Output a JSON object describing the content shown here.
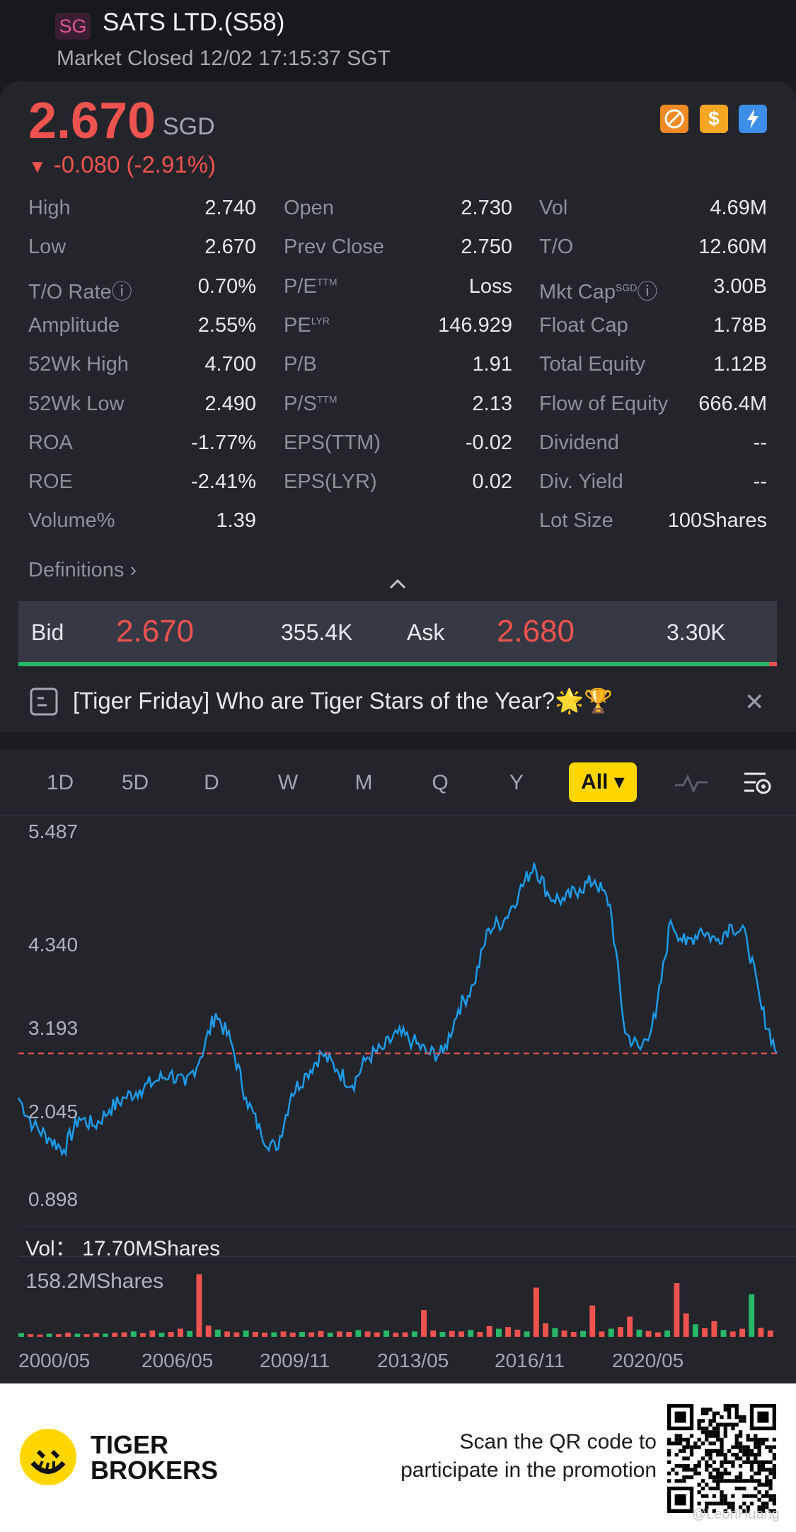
{
  "header": {
    "market_badge": "SG",
    "title": "SATS LTD.(S58)",
    "status": "Market Closed 12/02 17:15:37 SGT"
  },
  "quote": {
    "price": "2.670",
    "currency": "SGD",
    "change_arrow": "▼",
    "change": "-0.080 (-2.91%)",
    "up_color": "#27b86a",
    "down_color": "#ef5350",
    "icons": [
      "no-short-icon",
      "dividend-icon",
      "flash-icon"
    ]
  },
  "stats": {
    "col1": [
      {
        "label": "High",
        "value": "2.740"
      },
      {
        "label": "Low",
        "value": "2.670"
      },
      {
        "label": "T/O Rate",
        "value": "0.70%",
        "info": true
      },
      {
        "label": "Amplitude",
        "value": "2.55%"
      },
      {
        "label": "52Wk High",
        "value": "4.700"
      },
      {
        "label": "52Wk Low",
        "value": "2.490"
      },
      {
        "label": "ROA",
        "value": "-1.77%"
      },
      {
        "label": "ROE",
        "value": "-2.41%"
      },
      {
        "label": "Volume%",
        "value": "1.39"
      }
    ],
    "col2": [
      {
        "label": "Open",
        "value": "2.730"
      },
      {
        "label": "Prev Close",
        "value": "2.750"
      },
      {
        "label": "P/E",
        "sup": "TTM",
        "value": "Loss"
      },
      {
        "label": "PE",
        "sup": "LYR",
        "value": "146.929"
      },
      {
        "label": "P/B",
        "value": "1.91"
      },
      {
        "label": "P/S",
        "sup": "TTM",
        "value": "2.13"
      },
      {
        "label": "EPS(TTM)",
        "value": "-0.02"
      },
      {
        "label": "EPS(LYR)",
        "value": "0.02"
      }
    ],
    "col3": [
      {
        "label": "Vol",
        "value": "4.69M"
      },
      {
        "label": "T/O",
        "value": "12.60M"
      },
      {
        "label": "Mkt Cap",
        "sup": "SGD",
        "value": "3.00B",
        "info": true
      },
      {
        "label": "Float Cap",
        "value": "1.78B"
      },
      {
        "label": "Total Equity",
        "value": "1.12B"
      },
      {
        "label": "Flow of Equity",
        "value": "666.4M"
      },
      {
        "label": "Dividend",
        "value": "--"
      },
      {
        "label": "Div. Yield",
        "value": "--"
      },
      {
        "label": "Lot Size",
        "value": "100Shares"
      }
    ],
    "definitions_label": "Definitions"
  },
  "bidask": {
    "bid_label": "Bid",
    "bid_price": "2.670",
    "bid_size": "355.4K",
    "ask_label": "Ask",
    "ask_price": "2.680",
    "ask_size": "3.30K",
    "bid_ratio": 0.99
  },
  "news": {
    "text": "[Tiger Friday] Who are Tiger Stars of the Year?🌟🏆"
  },
  "chart_tabs": [
    "1D",
    "5D",
    "D",
    "W",
    "M",
    "Q",
    "Y",
    "All"
  ],
  "active_tab": "All",
  "chart_data": {
    "type": "line",
    "y_ticks": [
      "5.487",
      "4.340",
      "3.193",
      "2.045",
      "0.898"
    ],
    "ylim": [
      0.898,
      5.487
    ],
    "reference_line": 2.75,
    "line_color": "#1e9be8",
    "reference_color": "#ef5350",
    "x_ticks": [
      "2000/05",
      "2006/05",
      "2009/11",
      "2013/05",
      "2016/11",
      "2020/05"
    ],
    "series": [
      {
        "x": [
          "2000/05",
          "2001/01",
          "2001/06",
          "2002/01",
          "2002/09",
          "2003/04",
          "2003/09",
          "2004/03",
          "2004/09",
          "2005/03",
          "2005/09",
          "2006/05",
          "2006/12",
          "2007/06",
          "2007/11",
          "2008/03",
          "2008/08",
          "2009/01",
          "2009/06",
          "2009/11",
          "2010/05",
          "2010/11",
          "2011/05",
          "2011/11",
          "2012/05",
          "2012/11",
          "2013/05",
          "2013/11",
          "2014/05",
          "2014/11",
          "2015/05",
          "2015/11",
          "2016/05",
          "2016/11",
          "2017/05",
          "2017/11",
          "2018/05",
          "2018/11",
          "2019/05",
          "2019/11",
          "2020/02",
          "2020/03",
          "2020/05",
          "2020/08",
          "2020/11",
          "2021/03",
          "2021/08",
          "2022/01",
          "2022/06",
          "2022/10",
          "2022/12"
        ],
        "y": [
          2.2,
          1.85,
          1.7,
          1.55,
          1.95,
          1.85,
          2.05,
          2.2,
          2.3,
          2.4,
          2.5,
          2.35,
          2.7,
          3.25,
          2.9,
          2.2,
          1.75,
          1.55,
          2.25,
          2.5,
          2.75,
          2.55,
          2.35,
          2.7,
          2.8,
          3.0,
          2.9,
          2.75,
          2.75,
          3.3,
          3.6,
          4.3,
          4.4,
          4.75,
          5.1,
          4.7,
          4.65,
          4.8,
          4.9,
          4.6,
          3.0,
          2.8,
          3.2,
          4.4,
          4.1,
          4.3,
          4.15,
          4.35,
          4.2,
          3.3,
          2.75
        ]
      }
    ]
  },
  "volume": {
    "label": "Vol：",
    "value": "17.70MShares",
    "max_label": "158.2MShares",
    "max": 158.2,
    "bars": [
      8,
      6,
      5,
      7,
      6,
      9,
      7,
      6,
      8,
      7,
      9,
      10,
      12,
      8,
      14,
      9,
      11,
      18,
      13,
      140,
      25,
      16,
      12,
      10,
      14,
      11,
      9,
      10,
      12,
      9,
      11,
      10,
      13,
      9,
      12,
      11,
      15,
      12,
      10,
      14,
      9,
      10,
      12,
      60,
      14,
      11,
      13,
      12,
      15,
      11,
      24,
      18,
      22,
      16,
      12,
      110,
      30,
      19,
      14,
      11,
      13,
      70,
      12,
      18,
      22,
      45,
      16,
      13,
      10,
      14,
      120,
      52,
      28,
      19,
      35,
      15,
      12,
      18,
      95,
      20,
      14
    ]
  },
  "footer": {
    "brand_line1": "TIGER",
    "brand_line2": "BROKERS",
    "promo_line1": "Scan the QR code to",
    "promo_line2": "participate in the promotion",
    "watermark": "@LeonHuang"
  }
}
